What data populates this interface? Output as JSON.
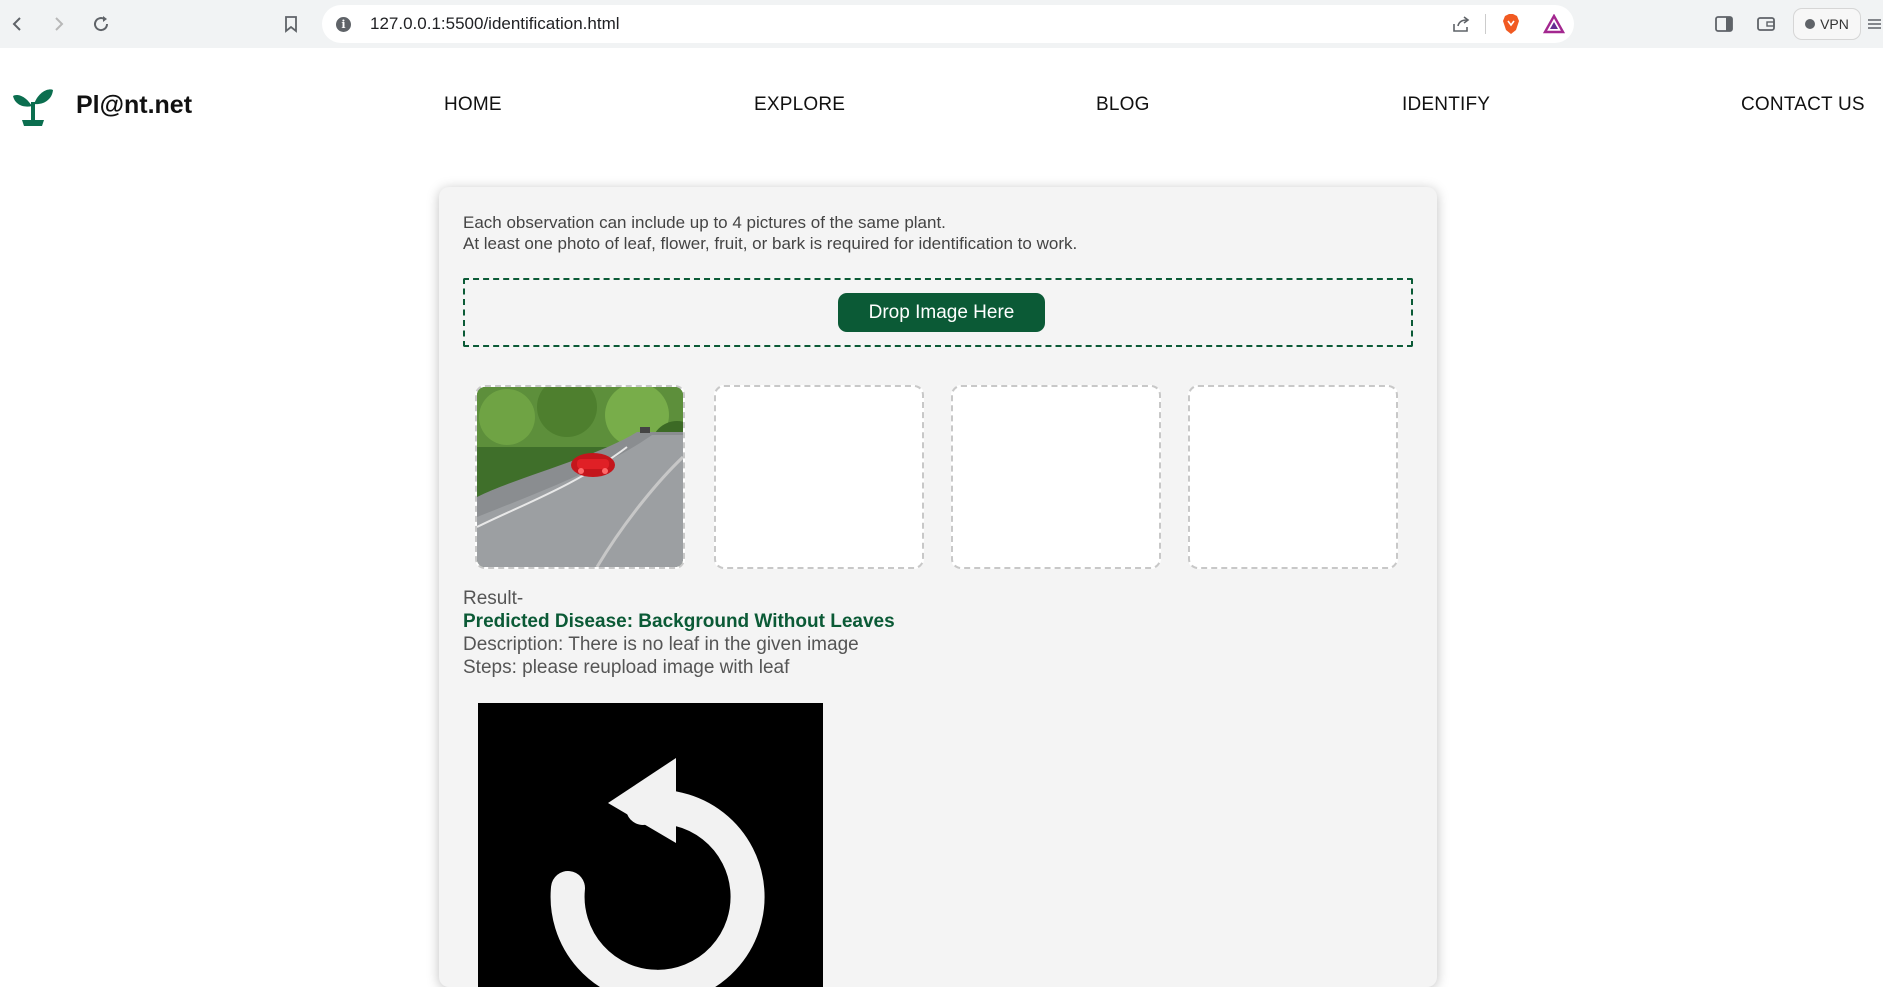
{
  "browser": {
    "url": "127.0.0.1:5500/identification.html",
    "vpn_label": "VPN"
  },
  "site": {
    "brand": "Pl@nt.net",
    "nav": [
      {
        "label": "HOME"
      },
      {
        "label": "EXPLORE"
      },
      {
        "label": "BLOG"
      },
      {
        "label": "IDENTIFY"
      },
      {
        "label": "CONTACT US"
      }
    ]
  },
  "identify": {
    "intro_line1": "Each observation can include up to 4 pictures of the same plant.",
    "intro_line2": "At least one photo of leaf, flower, fruit, or bark is required for identification to work.",
    "drop_label": "Drop Image Here",
    "result_heading": "Result-",
    "predicted": "Predicted Disease: Background Without Leaves",
    "description": "Description: There is no leaf in the given image",
    "steps": "Steps: please reupload image with leaf"
  },
  "colors": {
    "accent": "#0b5a36",
    "card_bg": "#f4f4f4"
  }
}
